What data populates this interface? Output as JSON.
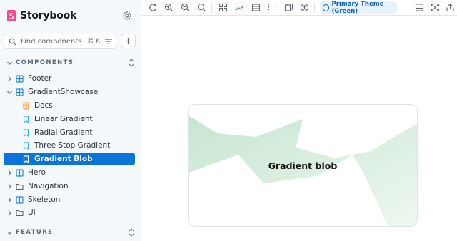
{
  "app": {
    "name": "Storybook"
  },
  "search": {
    "placeholder": "Find components",
    "shortcut": "⌘ K"
  },
  "sections": {
    "components": "COMPONENTS",
    "feature": "FEATURE"
  },
  "tree": [
    {
      "label": "Footer",
      "type": "component",
      "level": 0,
      "expanded": false
    },
    {
      "label": "GradientShowcase",
      "type": "component",
      "level": 0,
      "expanded": true
    },
    {
      "label": "Docs",
      "type": "docs",
      "level": 1
    },
    {
      "label": "Linear Gradient",
      "type": "story",
      "level": 1
    },
    {
      "label": "Radial Gradient",
      "type": "story",
      "level": 1
    },
    {
      "label": "Three Stop Gradient",
      "type": "story",
      "level": 1
    },
    {
      "label": "Gradient Blob",
      "type": "story",
      "level": 1,
      "selected": true
    },
    {
      "label": "Hero",
      "type": "component",
      "level": 0,
      "expanded": false
    },
    {
      "label": "Navigation",
      "type": "folder",
      "level": 0,
      "expanded": false
    },
    {
      "label": "Skeleton",
      "type": "component",
      "level": 0,
      "expanded": false
    },
    {
      "label": "UI",
      "type": "folder",
      "level": 0,
      "expanded": false
    }
  ],
  "toolbar": {
    "theme_label": "Primary Theme (Green)",
    "icons": [
      "reload-icon",
      "zoom-in-icon",
      "zoom-out-icon",
      "zoom-reset-icon",
      "grid-icon",
      "background-icon",
      "viewport-icon",
      "outline-icon",
      "measure-icon",
      "accessibility-icon",
      "sidebar-toggle-icon",
      "fullscreen-icon",
      "share-icon"
    ]
  },
  "preview": {
    "label": "Gradient blob"
  },
  "colors": {
    "accent": "#0b74d8",
    "brand": "#ff4785",
    "blob": "#cfe9d7"
  }
}
